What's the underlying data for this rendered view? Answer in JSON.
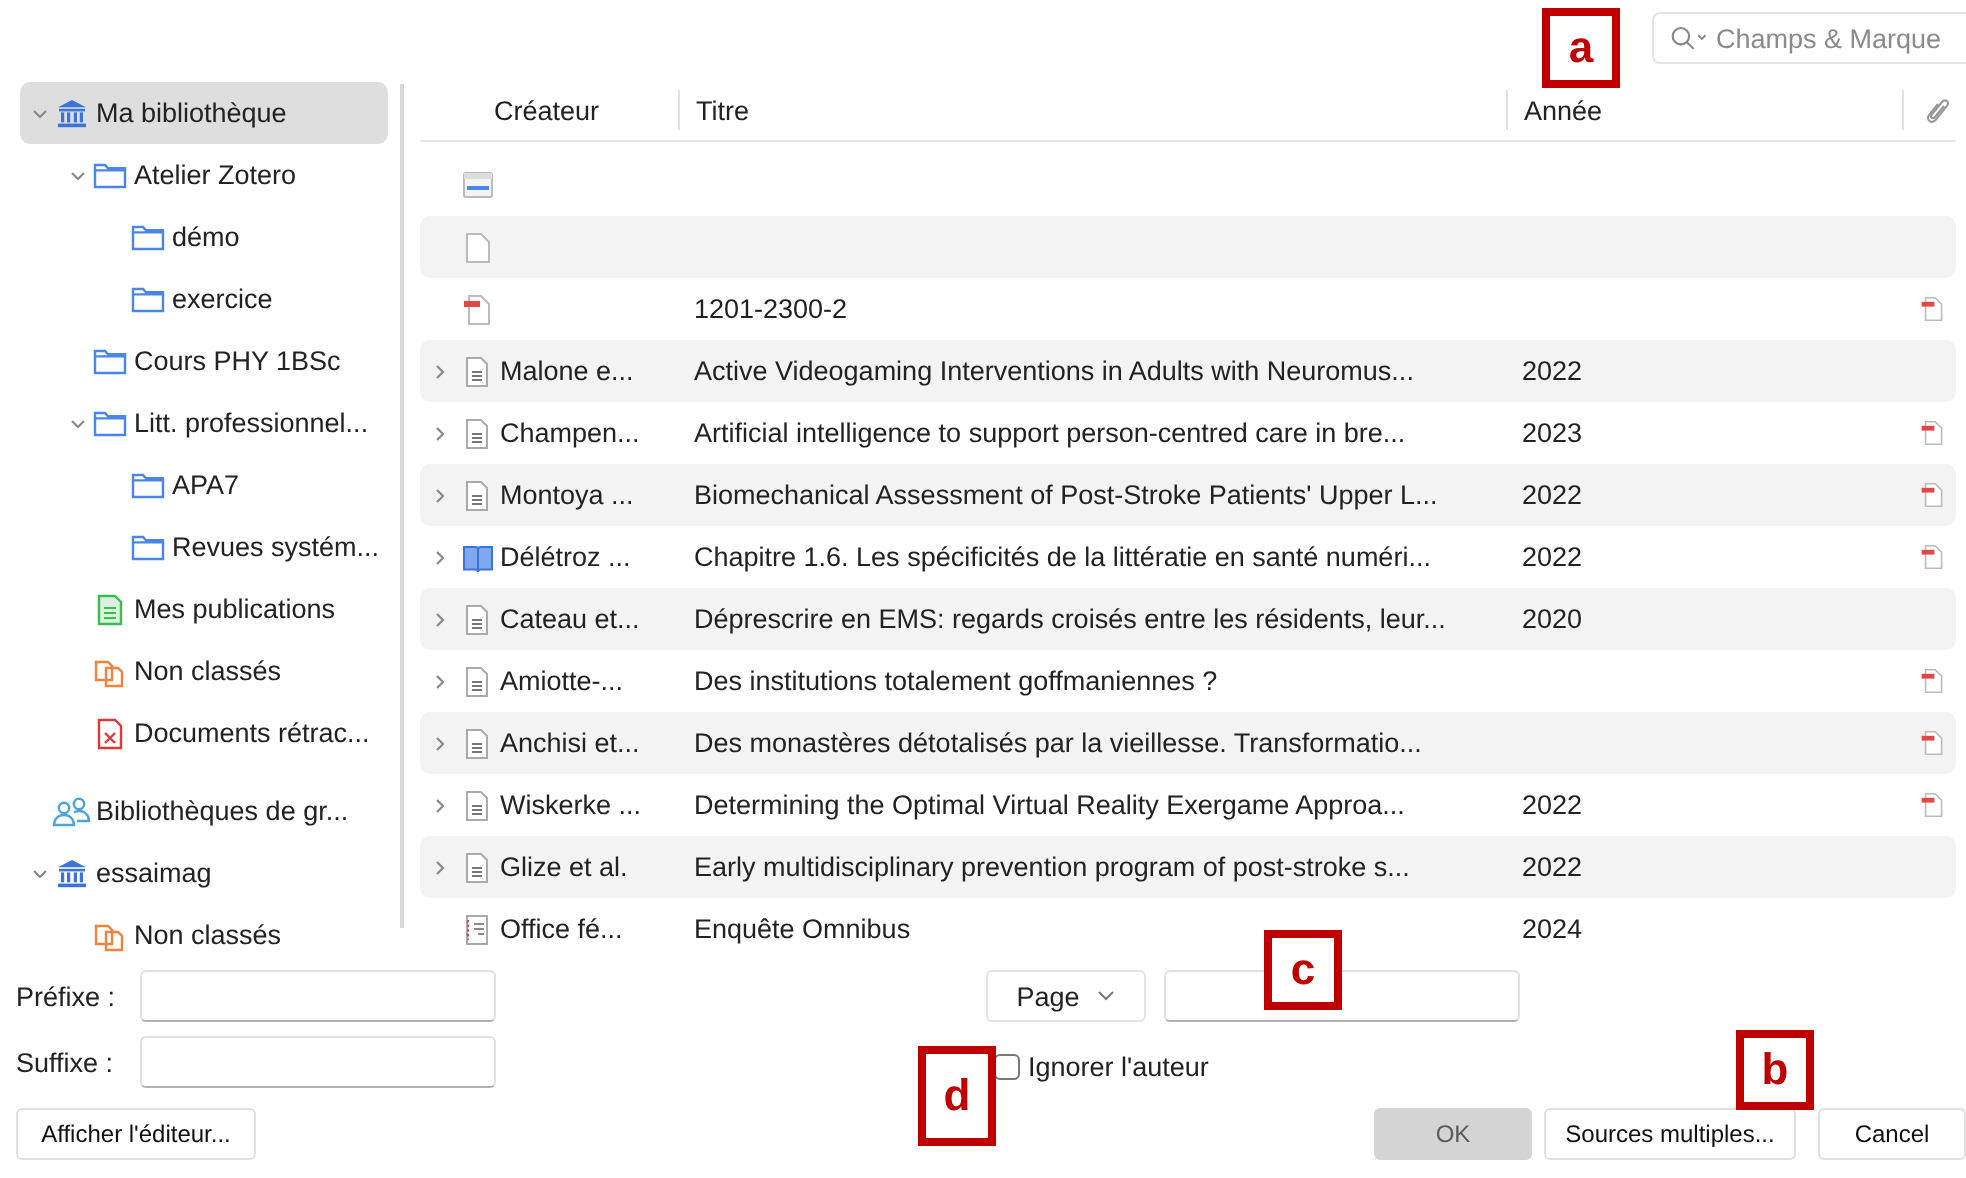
{
  "search": {
    "placeholder": "Champs & Marque"
  },
  "sidebar": {
    "items": [
      {
        "label": "Ma bibliothèque",
        "kind": "library",
        "expanded": true,
        "selected": true,
        "children": [
          {
            "label": "Atelier Zotero",
            "kind": "folder",
            "expanded": true,
            "selected": false,
            "children": [
              {
                "label": "démo",
                "kind": "folder",
                "selected": false
              },
              {
                "label": "exercice",
                "kind": "folder",
                "selected": false
              }
            ]
          },
          {
            "label": "Cours PHY 1BSc",
            "kind": "folder",
            "selected": false
          },
          {
            "label": "Litt. professionnel...",
            "kind": "folder",
            "expanded": true,
            "selected": false,
            "children": [
              {
                "label": "APA7",
                "kind": "folder",
                "selected": false
              },
              {
                "label": "Revues systém...",
                "kind": "folder",
                "selected": false
              }
            ]
          },
          {
            "label": "Mes publications",
            "kind": "publications",
            "selected": false
          },
          {
            "label": "Non classés",
            "kind": "unfiled",
            "selected": false
          },
          {
            "label": "Documents rétrac...",
            "kind": "retracted",
            "selected": false
          }
        ]
      },
      {
        "label": "Bibliothèques de gr...",
        "kind": "group",
        "selected": false
      },
      {
        "label": "essaimag",
        "kind": "library",
        "expanded": true,
        "selected": false,
        "children": [
          {
            "label": "Non classés",
            "kind": "unfiled",
            "selected": false
          }
        ]
      }
    ]
  },
  "table": {
    "columns": [
      "Créateur",
      "Titre",
      "Année"
    ],
    "rows": [
      {
        "kind": "webpage",
        "creator": "",
        "title": "",
        "year": "",
        "has_pdf": false
      },
      {
        "kind": "blank",
        "creator": "",
        "title": "",
        "year": "",
        "has_pdf": false
      },
      {
        "kind": "pdf",
        "creator": "",
        "title": "1201-2300-2",
        "year": "",
        "has_pdf": true
      },
      {
        "kind": "article",
        "expanded": false,
        "creator": "Malone e...",
        "title": "Active Videogaming Interventions in Adults with Neuromus...",
        "year": "2022",
        "has_pdf": false
      },
      {
        "kind": "article",
        "expanded": false,
        "creator": "Champen...",
        "title": "Artificial intelligence to support person-centred care in bre...",
        "year": "2023",
        "has_pdf": true
      },
      {
        "kind": "article",
        "expanded": false,
        "creator": "Montoya ...",
        "title": "Biomechanical Assessment of Post-Stroke Patients' Upper L...",
        "year": "2022",
        "has_pdf": true
      },
      {
        "kind": "book",
        "expanded": false,
        "creator": "Délétroz ...",
        "title": "Chapitre 1.6. Les spécificités de la littératie en santé numéri...",
        "year": "2022",
        "has_pdf": true
      },
      {
        "kind": "article",
        "expanded": false,
        "creator": "Cateau et...",
        "title": "Déprescrire en EMS: regards croisés entre les résidents, leur...",
        "year": "2020",
        "has_pdf": false
      },
      {
        "kind": "article",
        "expanded": false,
        "creator": "Amiotte-...",
        "title": "Des institutions totalement goffmaniennes ?",
        "year": "",
        "has_pdf": true
      },
      {
        "kind": "article",
        "expanded": false,
        "creator": "Anchisi et...",
        "title": "Des monastères détotalisés par la vieillesse. Transformatio...",
        "year": "",
        "has_pdf": true
      },
      {
        "kind": "article",
        "expanded": false,
        "creator": "Wiskerke ...",
        "title": "Determining the Optimal Virtual Reality Exergame Approa...",
        "year": "2022",
        "has_pdf": true
      },
      {
        "kind": "article",
        "expanded": false,
        "creator": "Glize et al.",
        "title": "Early multidisciplinary prevention program of post-stroke s...",
        "year": "2022",
        "has_pdf": false
      },
      {
        "kind": "report",
        "creator": "Office fé...",
        "title": "Enquête Omnibus",
        "year": "2024",
        "has_pdf": false
      }
    ]
  },
  "citation": {
    "prefix_label": "Préfixe :",
    "suffix_label": "Suffixe :",
    "locator": "Page",
    "omit_author": {
      "label": "Ignorer l'auteur",
      "checked": false
    }
  },
  "buttons": [
    {
      "label": "Afficher l'éditeur...",
      "disabled": false
    },
    {
      "label": "OK",
      "disabled": true
    },
    {
      "label": "Sources multiples...",
      "disabled": false
    },
    {
      "label": "Cancel",
      "disabled": false
    }
  ],
  "annotations": [
    {
      "label": "a"
    },
    {
      "label": "b"
    },
    {
      "label": "c"
    },
    {
      "label": "d"
    }
  ]
}
